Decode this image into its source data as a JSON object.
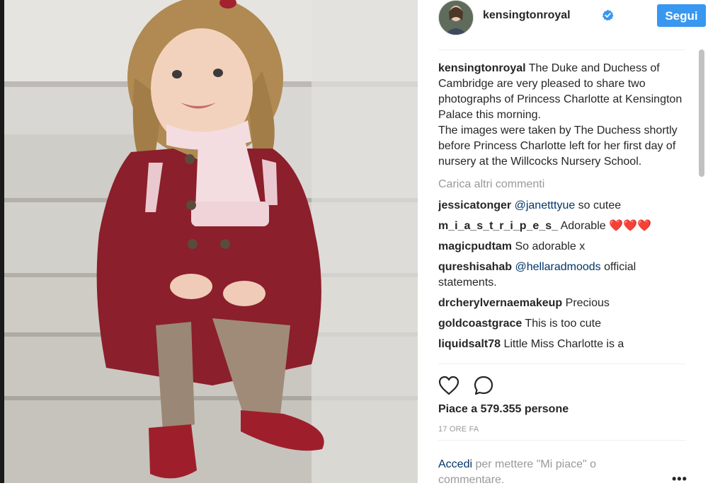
{
  "header": {
    "username": "kensingtonroyal",
    "follow_label": "Segui"
  },
  "caption": {
    "username": "kensingtonroyal",
    "line1": "The Duke and Duchess of Cambridge are very pleased to share two photographs of Princess Charlotte at Kensington Palace this morning.",
    "line2": "The images were taken by The Duchess shortly before Princess Charlotte left for her first day of nursery at the Willcocks Nursery School."
  },
  "load_more": "Carica altri commenti",
  "comments": [
    {
      "user": "jessicatonger",
      "mention": "@janetttyue",
      "text": " so cutee"
    },
    {
      "user": "m_i_a_s_t_r_i_p_e_s_",
      "text": " Adorable ",
      "emoji": "❤️❤️❤️"
    },
    {
      "user": "magicpudtam",
      "text": " So adorable x"
    },
    {
      "user": "qureshisahab",
      "mention": "@hellaradmoods",
      "text": " official statements."
    },
    {
      "user": "drcherylvernaemakeup",
      "text": " Precious"
    },
    {
      "user": "goldcoastgrace",
      "text": " This is too cute"
    },
    {
      "user": "liquidsalt78",
      "text": " Little Miss Charlotte is a"
    }
  ],
  "likes": "Piace a 579.355 persone",
  "timestamp": "17 ORE FA",
  "login": {
    "link": "Accedi",
    "text": " per mettere \"Mi piace\" o commentare."
  },
  "icons": {
    "verified": "verified-badge-icon",
    "like": "heart-outline-icon",
    "comment": "speech-bubble-icon",
    "more": "more-dots-icon"
  },
  "colors": {
    "accent": "#3897f0",
    "link": "#003569",
    "muted": "#999999"
  }
}
